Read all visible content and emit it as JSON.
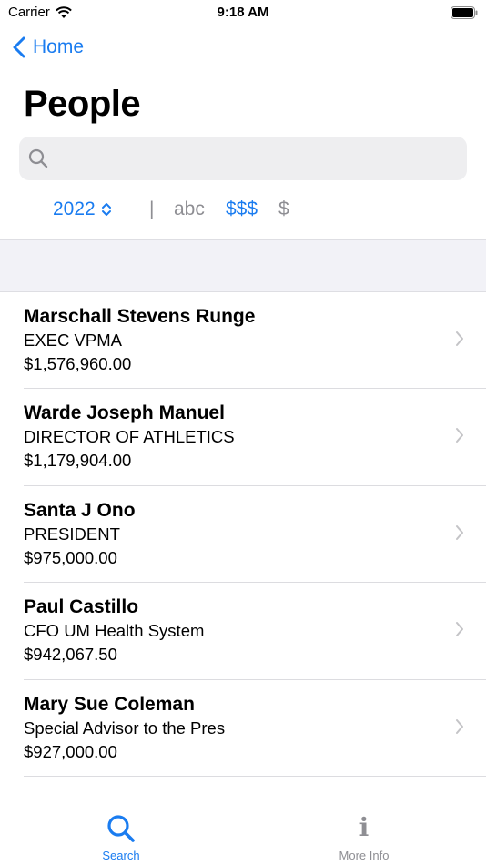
{
  "status_bar": {
    "carrier": "Carrier",
    "time": "9:18 AM"
  },
  "nav": {
    "back_label": "Home",
    "title": "People"
  },
  "search": {
    "value": "",
    "placeholder": ""
  },
  "filters": {
    "year": "2022",
    "separator": "|",
    "sort_alpha": "abc",
    "sort_high": "$$$",
    "sort_low": "$",
    "active": "$$$"
  },
  "people": [
    {
      "name": "Marschall Stevens Runge",
      "title": "EXEC VPMA",
      "salary": "$1,576,960.00"
    },
    {
      "name": "Warde Joseph Manuel",
      "title": "DIRECTOR OF ATHLETICS",
      "salary": "$1,179,904.00"
    },
    {
      "name": "Santa J Ono",
      "title": "PRESIDENT",
      "salary": "$975,000.00"
    },
    {
      "name": "Paul Castillo",
      "title": "CFO UM Health System",
      "salary": "$942,067.50"
    },
    {
      "name": "Mary Sue Coleman",
      "title": "Special Advisor to the Pres",
      "salary": "$927,000.00"
    }
  ],
  "tab_bar": {
    "search_label": "Search",
    "more_info_label": "More Info",
    "active": "Search"
  },
  "colors": {
    "accent": "#1a7cf0",
    "inactive": "#8e8e93",
    "section_bg": "#f2f2f7"
  }
}
